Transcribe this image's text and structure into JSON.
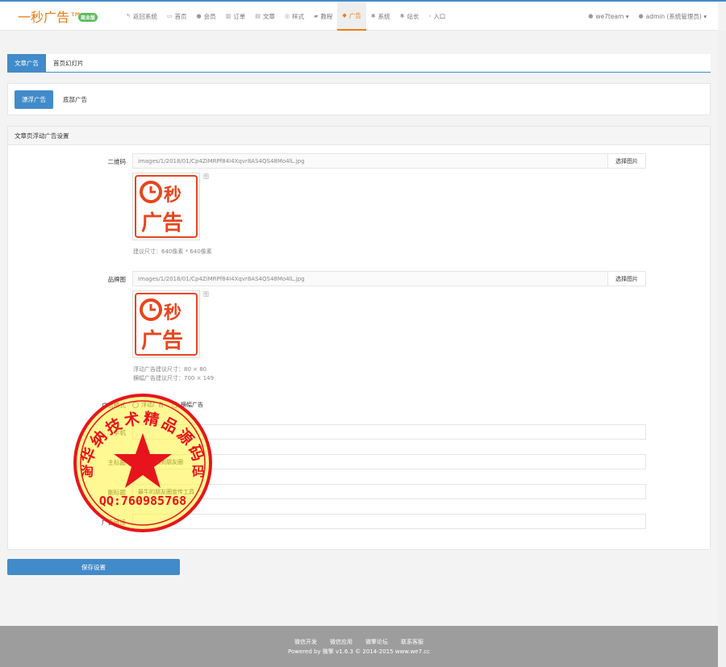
{
  "brand": {
    "title": "一秒广告™",
    "badge": "商业版"
  },
  "nav": [
    {
      "icon": "reply-icon",
      "glyph": "↰",
      "label": "返回系统"
    },
    {
      "icon": "desktop-icon",
      "glyph": "▭",
      "label": "首页"
    },
    {
      "icon": "user-icon",
      "glyph": "●",
      "label": "会员"
    },
    {
      "icon": "chart-icon",
      "glyph": "▥",
      "label": "订单"
    },
    {
      "icon": "file-icon",
      "glyph": "▤",
      "label": "文章"
    },
    {
      "icon": "lifebuoy-icon",
      "glyph": "◎",
      "label": "样式"
    },
    {
      "icon": "book-icon",
      "glyph": "▰",
      "label": "教程"
    },
    {
      "icon": "comments-icon",
      "glyph": "◆",
      "label": "广告"
    },
    {
      "icon": "cog-icon",
      "glyph": "✱",
      "label": "系统"
    },
    {
      "icon": "cog-icon",
      "glyph": "✱",
      "label": "站长"
    },
    {
      "icon": "chevron-right-icon",
      "glyph": "›",
      "label": "入口"
    }
  ],
  "nav_right": [
    {
      "icon": "users-icon",
      "glyph": "●",
      "label": "we7team ▾"
    },
    {
      "icon": "user-icon",
      "glyph": "●",
      "label": "admin (系统管理员) ▾"
    }
  ],
  "tabs": [
    "文章广告",
    "首页幻灯片"
  ],
  "pills": [
    "漂浮广告",
    "底部广告"
  ],
  "panel_title": "文章页浮动广告设置",
  "fields": {
    "qrcode": {
      "label": "二维码",
      "value": "images/1/2018/01/Cp4ZiMRPf84I4Xqvr8AS4QS48Mo4lL.jpg",
      "button": "选择图片",
      "help": "建议尺寸：640像素 * 640像素"
    },
    "brand_img": {
      "label": "品牌图",
      "value": "images/1/2018/01/Cp4ZiMRPf84I4Xqvr8AS4QS48Mo4lL.jpg",
      "button": "选择图片",
      "help1": "浮动广告建议尺寸：80 × 80",
      "help2": "横幅广告建议尺寸：700 × 149"
    },
    "ad_type": {
      "label": "广告模式",
      "options": [
        "浮动广告",
        "横幅广告"
      ]
    },
    "phone": {
      "label": "手机"
    },
    "main_title": {
      "label": "主标题",
      "value": "把广告贴到朋友圈"
    },
    "sub_title": {
      "label": "副标题",
      "value": "最牛的朋友圈宣传工具"
    },
    "link": {
      "label": "广告链接"
    }
  },
  "logo_text": {
    "line1": "秒",
    "line2": "广告"
  },
  "close_glyph": "图",
  "save_button": "保存设置",
  "stamp": {
    "top_text": "华纳技术精品源码",
    "bottom_text": "QQ:760985768",
    "left_char": "淘",
    "right_char": "码"
  },
  "footer": {
    "links": [
      "微信开发",
      "微信应用",
      "微擎论坛",
      "联系客服"
    ],
    "copyright": "Powered by 微擎 v1.6.3 © 2014-2015 www.we7.cc"
  },
  "colors": {
    "accent": "#428bca",
    "brand": "#ef7a11",
    "logo_red": "#e8451d",
    "stamp_red": "#e8141d",
    "stamp_yellow": "#fff23a"
  }
}
